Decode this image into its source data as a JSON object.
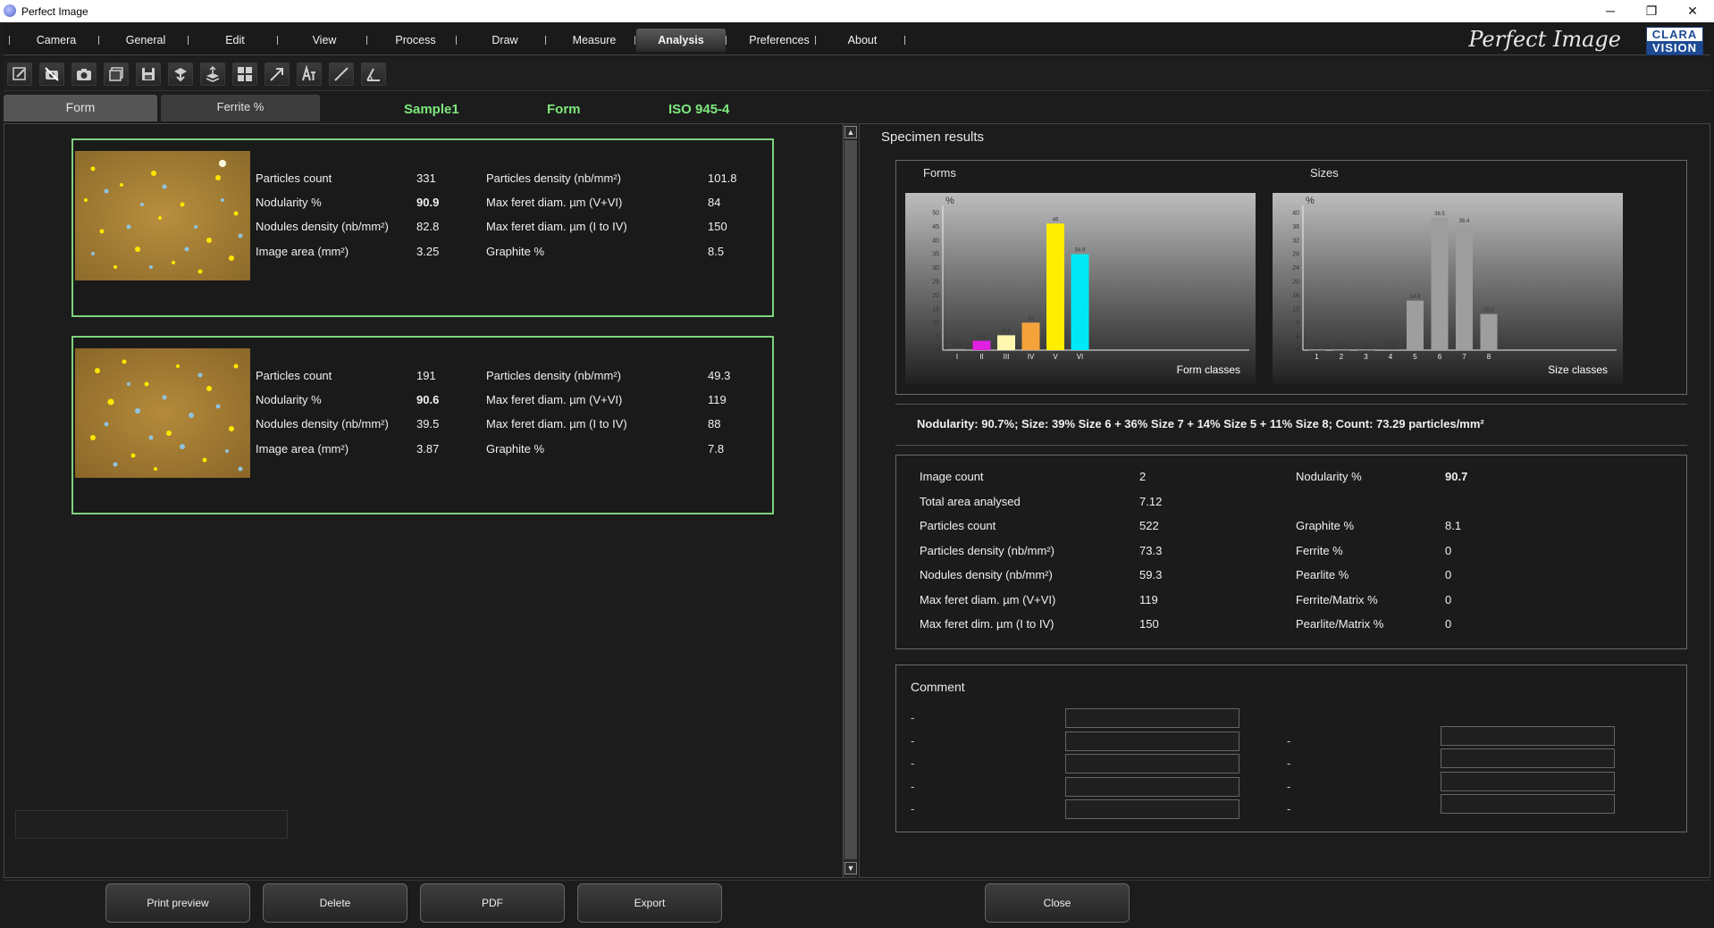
{
  "window": {
    "title": "Perfect Image",
    "minimize": "─",
    "restore": "❐",
    "close": "✕"
  },
  "menu": {
    "items": [
      "Camera",
      "General",
      "Edit",
      "View",
      "Process",
      "Draw",
      "Measure",
      "Analysis",
      "Preferences",
      "About"
    ],
    "active": "Analysis",
    "brand": "Perfect Image",
    "logo_top": "CLARA",
    "logo_bottom": "VISION"
  },
  "toolbar": {
    "icons": [
      "edit-icon",
      "no-camera-icon",
      "camera-icon",
      "image-stack-icon",
      "save-icon",
      "import-icon",
      "export-layers-icon",
      "grid-icon",
      "arrow-icon",
      "text-icon",
      "line-icon",
      "angle-icon"
    ]
  },
  "tabs": {
    "form": "Form",
    "ferrite": "Ferrite %"
  },
  "header": {
    "sample": "Sample1",
    "mode": "Form",
    "standard": "ISO 945-4"
  },
  "colors": {
    "accent_green": "#7ed17e",
    "header_green": "#7ee87e",
    "bar_yellow": "#ffee00",
    "bar_cyan": "#00e8f5",
    "bar_magenta": "#e020e0",
    "bar_orange": "#f3a33a",
    "bar_cream": "#fff7b0",
    "bar_gray": "#9e9e9e"
  },
  "images": [
    {
      "rows": [
        {
          "l1": "Particles count",
          "v1": "331",
          "l2": "Particles density (nb/mm²)",
          "v2": "101.8"
        },
        {
          "l1": "Nodularity %",
          "v1": "90.9",
          "l2": "Max feret diam. µm (V+VI)",
          "v2": "84"
        },
        {
          "l1": "Nodules density (nb/mm²)",
          "v1": "82.8",
          "l2": "Max feret diam. µm (I to IV)",
          "v2": "150"
        },
        {
          "l1": "Image area (mm²)",
          "v1": "3.25",
          "l2": "Graphite %",
          "v2": "8.5"
        }
      ]
    },
    {
      "rows": [
        {
          "l1": "Particles count",
          "v1": "191",
          "l2": "Particles density (nb/mm²)",
          "v2": "49.3"
        },
        {
          "l1": "Nodularity %",
          "v1": "90.6",
          "l2": "Max feret diam. µm (V+VI)",
          "v2": "119"
        },
        {
          "l1": "Nodules density (nb/mm²)",
          "v1": "39.5",
          "l2": "Max feret diam. µm (I to IV)",
          "v2": "88"
        },
        {
          "l1": "Image area (mm²)",
          "v1": "3.87",
          "l2": "Graphite %",
          "v2": "7.8"
        }
      ]
    }
  ],
  "results": {
    "title": "Specimen results",
    "forms_label": "Forms",
    "sizes_label": "Sizes",
    "summary": "Nodularity: 90.7%; Size: 39% Size 6 + 36% Size 7 + 14% Size 5 + 11% Size 8; Count: 73.29 particles/mm²",
    "stats_left": [
      {
        "label": "Image count",
        "value": "2"
      },
      {
        "label": "Total area analysed",
        "value": "7.12"
      },
      {
        "label": "Particles count",
        "value": "522"
      },
      {
        "label": "Particles density (nb/mm²)",
        "value": "73.3"
      },
      {
        "label": "Nodules density (nb/mm²)",
        "value": "59.3"
      },
      {
        "label": "Max feret diam. µm (V+VI)",
        "value": "119"
      },
      {
        "label": "Max feret dim. µm (I to IV)",
        "value": "150"
      }
    ],
    "stats_right": [
      {
        "label": "Nodularity %",
        "value": "90.7"
      },
      {
        "label": "",
        "value": ""
      },
      {
        "label": "Graphite %",
        "value": "8.1"
      },
      {
        "label": "Ferrite %",
        "value": "0"
      },
      {
        "label": "Pearlite %",
        "value": "0"
      },
      {
        "label": "Ferrite/Matrix %",
        "value": "0"
      },
      {
        "label": "Pearlite/Matrix %",
        "value": "0"
      }
    ],
    "comment": {
      "label": "Comment",
      "dash": "-"
    }
  },
  "chart_data": [
    {
      "type": "bar",
      "title": "",
      "xlabel": "Form classes",
      "ylabel": "%",
      "ylim": [
        0,
        50
      ],
      "yticks": [
        0,
        5,
        10,
        15,
        20,
        25,
        30,
        35,
        40,
        45,
        50
      ],
      "categories": [
        "I",
        "II",
        "III",
        "IV",
        "V",
        "VI"
      ],
      "values": [
        0.4,
        3.4,
        5.4,
        10,
        46,
        34.9
      ],
      "colors": [
        "#9e9e9e",
        "#e020e0",
        "#fff7b0",
        "#f3a33a",
        "#ffee00",
        "#00e8f5"
      ]
    },
    {
      "type": "bar",
      "title": "",
      "xlabel": "Size classes",
      "ylabel": "%",
      "ylim": [
        0,
        40
      ],
      "yticks": [
        0,
        4,
        8,
        12,
        16,
        20,
        24,
        28,
        32,
        36,
        40
      ],
      "categories": [
        "1",
        "2",
        "3",
        "4",
        "5",
        "6",
        "7",
        "8"
      ],
      "values": [
        0,
        0,
        0,
        0.2,
        14.4,
        38.5,
        36.4,
        10.5
      ],
      "colors": [
        "#9e9e9e",
        "#9e9e9e",
        "#9e9e9e",
        "#9e9e9e",
        "#9e9e9e",
        "#9e9e9e",
        "#9e9e9e",
        "#9e9e9e"
      ]
    }
  ],
  "buttons": {
    "print": "Print preview",
    "delete": "Delete",
    "pdf": "PDF",
    "export": "Export",
    "close": "Close"
  }
}
